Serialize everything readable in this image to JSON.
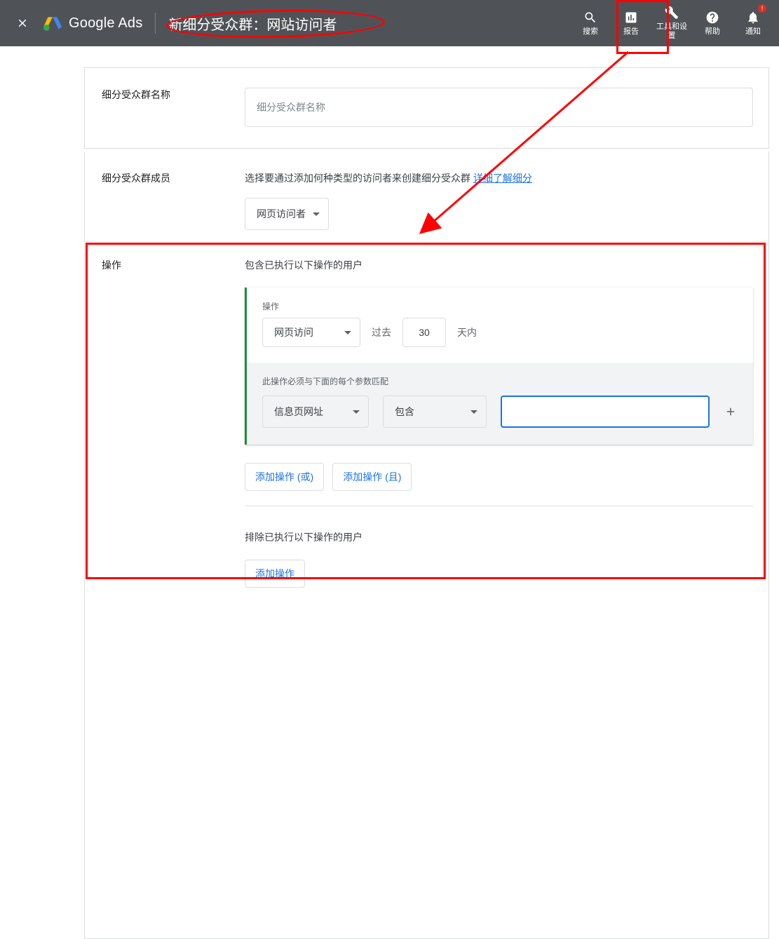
{
  "header": {
    "brand": "Google Ads",
    "page_title": "新细分受众群：网站访问者",
    "nav": {
      "search": "搜索",
      "reports": "报告",
      "tools": "工具和设置",
      "help": "帮助",
      "notifications": "通知",
      "notif_badge": "!"
    }
  },
  "section_name": {
    "label": "细分受众群名称",
    "placeholder": "细分受众群名称"
  },
  "section_members": {
    "label": "细分受众群成员",
    "help_text": "选择要通过添加何种类型的访问者来创建细分受众群 ",
    "help_link": "详细了解细分",
    "visitor_dropdown": "网页访问者"
  },
  "section_actions": {
    "label": "操作",
    "include_header": "包含已执行以下操作的用户",
    "action_block": {
      "label": "操作",
      "action_dropdown": "网页访问",
      "past_label": "过去",
      "days_value": "30",
      "days_suffix": "天内",
      "match_label": "此操作必须与下面的每个参数匹配",
      "param_dropdown": "信息页网址",
      "contain_dropdown": "包含"
    },
    "add_or": "添加操作 (或)",
    "add_and": "添加操作 (且)",
    "exclude_header": "排除已执行以下操作的用户",
    "add_action": "添加操作"
  }
}
